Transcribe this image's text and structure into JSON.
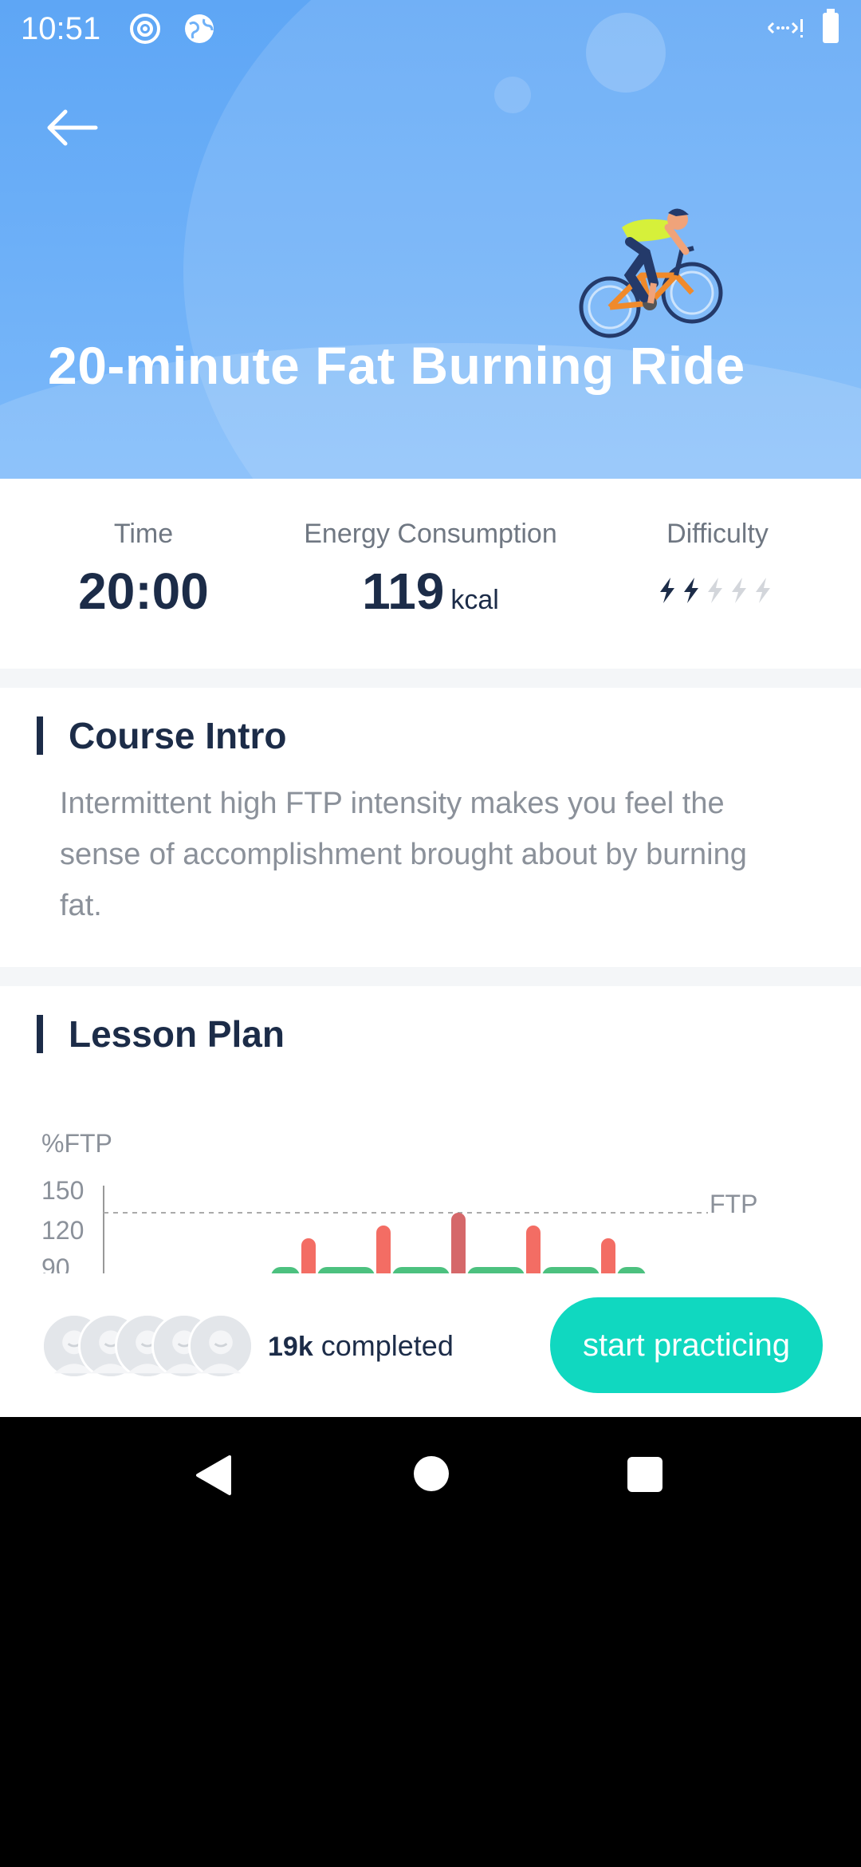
{
  "status_bar": {
    "time": "10:51"
  },
  "header": {
    "title": "20-minute Fat Burning Ride"
  },
  "stats": {
    "time": {
      "label": "Time",
      "value": "20:00"
    },
    "energy": {
      "label": "Energy Consumption",
      "value": "119",
      "unit": "kcal"
    },
    "difficulty": {
      "label": "Difficulty",
      "level": 2,
      "max": 5
    }
  },
  "course_intro": {
    "heading": "Course Intro",
    "text": "Intermittent high FTP intensity makes you feel the sense of accomplishment brought about by burning fat."
  },
  "lesson_plan": {
    "heading": "Lesson Plan"
  },
  "chart_data": {
    "type": "bar",
    "ylabel": "%FTP",
    "y_ticks": [
      "150",
      "120",
      "90"
    ],
    "reference_line": {
      "label": "FTP",
      "value": 120
    },
    "colors": {
      "interval": "#f36d64",
      "peak": "#d5686a",
      "recovery": "#4cc17f",
      "axis": "#999999"
    }
  },
  "bottom_bar": {
    "completed_count": "19k",
    "completed_label": "completed",
    "start_label": "start practicing"
  },
  "theme": {
    "hero_blue": "#5ea6f5",
    "accent_teal": "#10d8c0",
    "navy": "#1c2c48"
  }
}
